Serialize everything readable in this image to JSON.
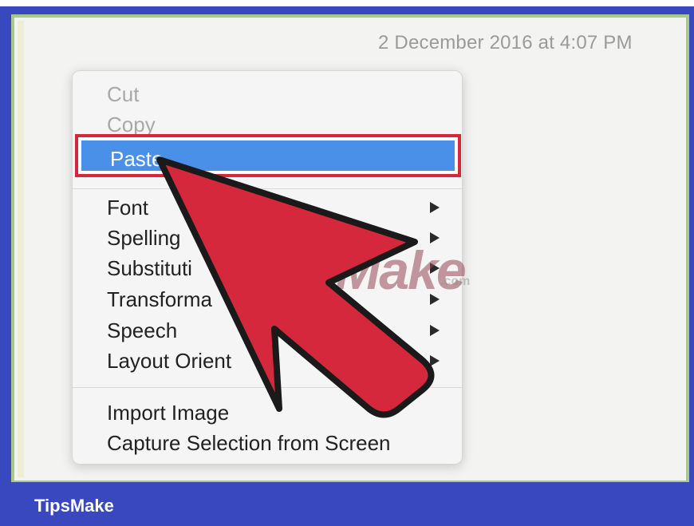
{
  "note": {
    "timestamp": "2 December 2016 at 4:07 PM"
  },
  "context_menu": {
    "items": [
      {
        "label": "Cut",
        "enabled": false,
        "has_submenu": false
      },
      {
        "label": "Copy",
        "enabled": false,
        "has_submenu": false
      },
      {
        "label": "Paste",
        "enabled": true,
        "has_submenu": false,
        "highlighted": true
      },
      {
        "label": "Font",
        "enabled": true,
        "has_submenu": true
      },
      {
        "label": "Spelling",
        "enabled": true,
        "has_submenu": true
      },
      {
        "label": "Substituti",
        "enabled": true,
        "has_submenu": true
      },
      {
        "label": "Transforma",
        "enabled": true,
        "has_submenu": true
      },
      {
        "label": "Speech",
        "enabled": true,
        "has_submenu": true
      },
      {
        "label": "Layout Orient",
        "enabled": true,
        "has_submenu": true
      },
      {
        "label": "Import Image",
        "enabled": true,
        "has_submenu": false
      },
      {
        "label": "Capture Selection from Screen",
        "enabled": true,
        "has_submenu": false
      }
    ]
  },
  "watermark": {
    "text": "TipsMake",
    "suffix": ".com"
  },
  "footer": {
    "brand": "TipsMake"
  },
  "colors": {
    "frame_blue": "#3a48c0",
    "highlight_blue": "#4a90e8",
    "annotation_red": "#d6283c"
  },
  "icons": {
    "submenu": "triangle-right-icon",
    "annotation": "red-pointer-arrow"
  }
}
